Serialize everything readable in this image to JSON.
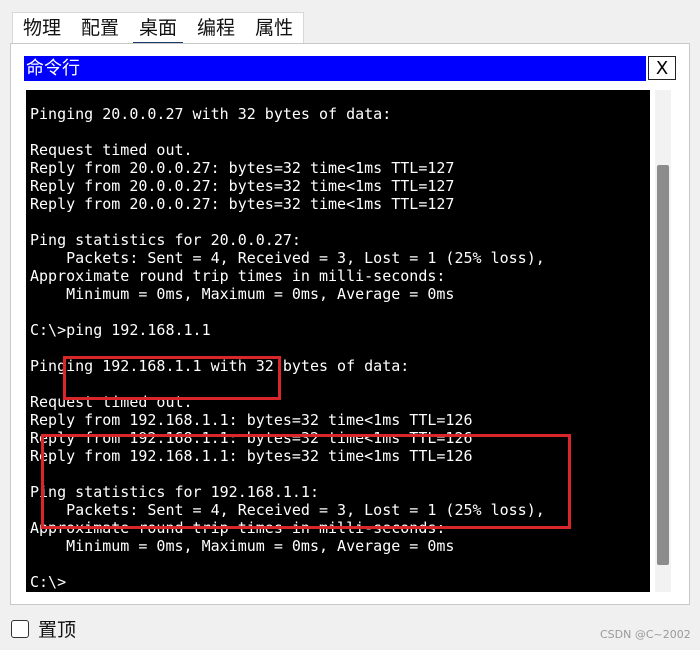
{
  "tabs": [
    "物理",
    "配置",
    "桌面",
    "编程",
    "属性"
  ],
  "active_tab": "桌面",
  "window": {
    "title": "命令行",
    "close_label": "X"
  },
  "terminal": {
    "lines": [
      "Pinging 20.0.0.27 with 32 bytes of data:",
      "",
      "Request timed out.",
      "Reply from 20.0.0.27: bytes=32 time<1ms TTL=127",
      "Reply from 20.0.0.27: bytes=32 time<1ms TTL=127",
      "Reply from 20.0.0.27: bytes=32 time<1ms TTL=127",
      "",
      "Ping statistics for 20.0.0.27:",
      "    Packets: Sent = 4, Received = 3, Lost = 1 (25% loss),",
      "Approximate round trip times in milli-seconds:",
      "    Minimum = 0ms, Maximum = 0ms, Average = 0ms",
      "",
      "C:\\>ping 192.168.1.1",
      "",
      "Pinging 192.168.1.1 with 32 bytes of data:",
      "",
      "Request timed out.",
      "Reply from 192.168.1.1: bytes=32 time<1ms TTL=126",
      "Reply from 192.168.1.1: bytes=32 time<1ms TTL=126",
      "Reply from 192.168.1.1: bytes=32 time<1ms TTL=126",
      "",
      "Ping statistics for 192.168.1.1:",
      "    Packets: Sent = 4, Received = 3, Lost = 1 (25% loss),",
      "Approximate round trip times in milli-seconds:",
      "    Minimum = 0ms, Maximum = 0ms, Average = 0ms",
      "",
      "C:\\>"
    ]
  },
  "always_on_top_label": "置顶",
  "watermark": "CSDN @C~2002",
  "colors": {
    "titlebar": "#0000ff",
    "terminal_bg": "#000000",
    "highlight": "#d9262b",
    "tab_underline": "#1a3a6b"
  }
}
